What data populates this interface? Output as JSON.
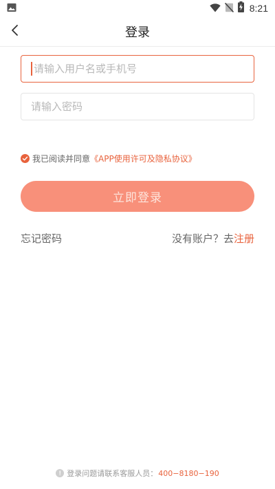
{
  "status_bar": {
    "time": "8:21",
    "icons": [
      "image-icon",
      "wifi-icon",
      "no-signal-icon",
      "battery-charging-icon"
    ]
  },
  "header": {
    "title": "登录",
    "back_icon": "chevron-left-icon"
  },
  "form": {
    "username_placeholder": "请输入用户名或手机号",
    "username_value": "",
    "password_placeholder": "请输入密码",
    "password_value": ""
  },
  "agreement": {
    "checked": true,
    "prefix": "我已阅读并同意",
    "link": "《APP使用许可及隐私协议》"
  },
  "login_button": "立即登录",
  "links": {
    "forgot": "忘记密码",
    "no_account": "没有账户？去",
    "register": "注册"
  },
  "footer": {
    "text": "登录问题请联系客服人员：",
    "phone": "400−8180−190"
  },
  "colors": {
    "accent": "#e8623c",
    "button_bg": "#f8907a",
    "button_text": "#fde4dc",
    "placeholder": "#b8b8b8"
  }
}
